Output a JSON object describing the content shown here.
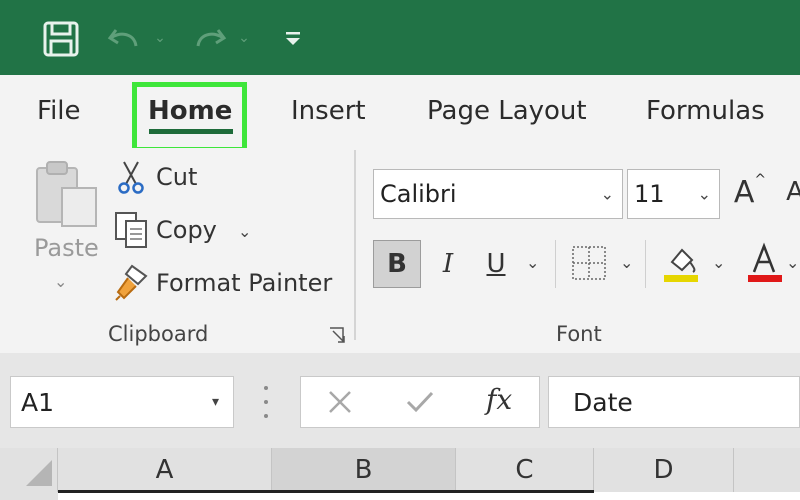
{
  "ribbon_tabs": [
    "File",
    "Home",
    "Insert",
    "Page Layout",
    "Formulas"
  ],
  "active_tab": "Home",
  "clipboard": {
    "paste_label": "Paste",
    "cut_label": "Cut",
    "copy_label": "Copy",
    "format_painter_label": "Format Painter",
    "group_label": "Clipboard"
  },
  "font": {
    "font_name": "Calibri",
    "font_size": "11",
    "bold_label": "B",
    "italic_label": "I",
    "underline_label": "U",
    "grow_label": "A",
    "group_label": "Font"
  },
  "formula_bar": {
    "name_box": "A1",
    "fx_label": "fx",
    "content": "Date"
  },
  "columns": [
    "A",
    "B",
    "C",
    "D"
  ],
  "colors": {
    "title_bar": "#217346",
    "highlight": "#3ee63a",
    "fill_color": "#e6d600",
    "font_color": "#e01818"
  }
}
